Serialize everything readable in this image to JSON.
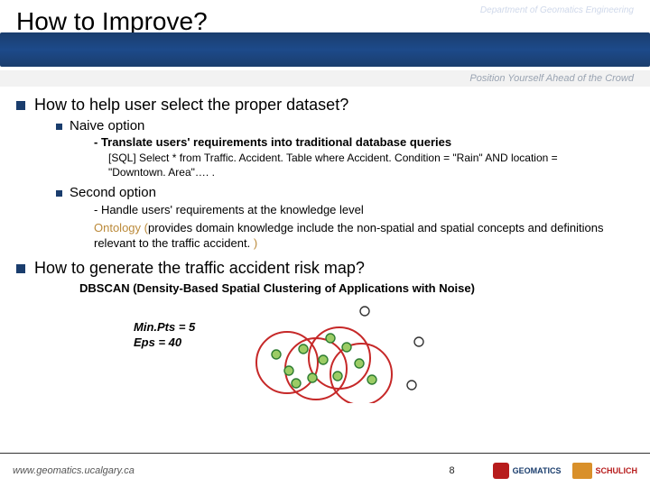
{
  "header": {
    "title": "How to Improve?",
    "department": "Department of Geomatics Engineering",
    "tagline": "Position Yourself Ahead of the Crowd"
  },
  "bullets": {
    "q1": "How to help user select the proper dataset?",
    "naive_label": "Naive option",
    "naive_line1": "- Translate users' requirements into traditional database queries",
    "naive_sql": "[SQL]  Select * from Traffic. Accident. Table where Accident. Condition = \"Rain\" AND location = \"Downtown. Area\"…. .",
    "second_label": "Second option",
    "second_line1": "- Handle users' requirements at the knowledge level",
    "ontology_word": "Ontology",
    "ontology_open": " (",
    "ontology_body": "provides domain knowledge include the non-spatial and spatial concepts and definitions relevant to the traffic accident.",
    "ontology_close": " )",
    "q2": "How to generate the traffic accident risk map?",
    "dbscan": "DBSCAN (Density-Based Spatial Clustering of Applications with Noise)",
    "params_minpts": "Min.Pts = 5",
    "params_eps": "Eps = 40"
  },
  "footer": {
    "url": "www.geomatics.ucalgary.ca",
    "page": "8",
    "logo1": "GEOMATICS",
    "logo2": "SCHULICH"
  }
}
